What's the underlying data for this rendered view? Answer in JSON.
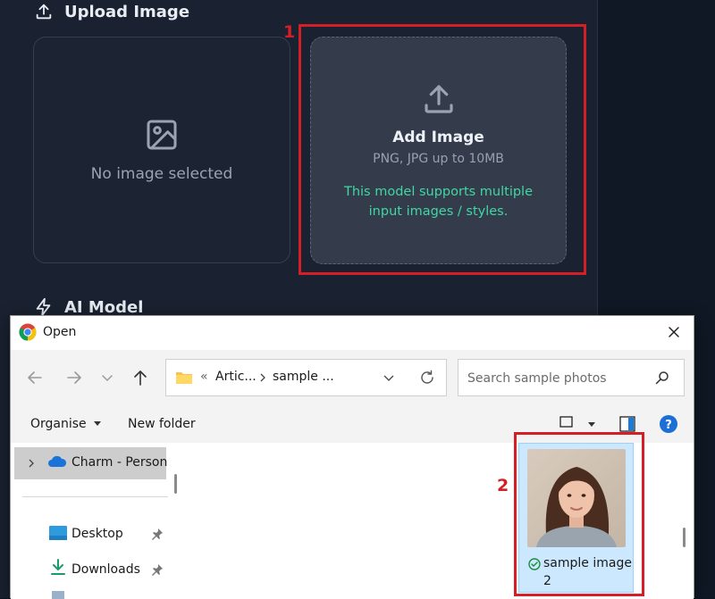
{
  "app": {
    "upload_section_title": "Upload Image",
    "ai_model_section_title": "AI Model",
    "empty_card_label": "No image selected",
    "add_card": {
      "title": "Add Image",
      "formats": "PNG, JPG up to 10MB",
      "note": "This model supports multiple input images / styles."
    }
  },
  "annotations": {
    "marker_1": "1",
    "marker_2": "2",
    "color": "#d41f26"
  },
  "dialog": {
    "title": "Open",
    "address": {
      "crumb_prefix": "«",
      "crumb_1": "Artic...",
      "crumb_2": "sample ..."
    },
    "search_placeholder": "Search sample photos",
    "toolbar": {
      "organise": "Organise",
      "new_folder": "New folder"
    },
    "sidebar": {
      "items": [
        {
          "label": "Charm - Personal",
          "icon": "onedrive-icon"
        },
        {
          "label": "Desktop",
          "icon": "desktop-icon"
        },
        {
          "label": "Downloads",
          "icon": "downloads-icon"
        }
      ]
    },
    "file": {
      "name": "sample image 2",
      "status_icon": "sync-check-icon"
    }
  }
}
